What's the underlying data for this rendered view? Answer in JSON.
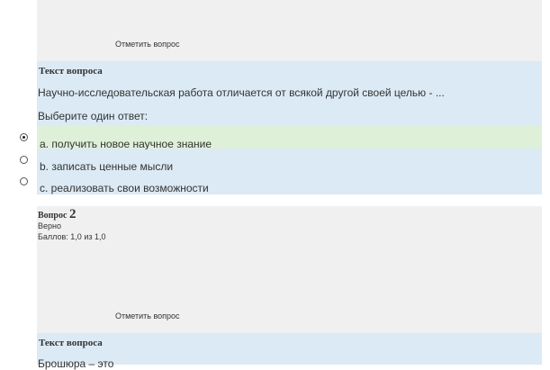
{
  "question1": {
    "flag_label": "Отметить вопрос",
    "qtext_label": "Текст вопроса",
    "qtext": "Научно-исследовательская работа отличается от всякой другой своей целью - ...",
    "prompt": "Выберите один ответ:",
    "answers": [
      {
        "label": "a. получить новое научное знание",
        "selected": true
      },
      {
        "label": "b. записать ценные мысли",
        "selected": false
      },
      {
        "label": "c. реализовать свои возможности",
        "selected": false
      }
    ]
  },
  "question2": {
    "title_prefix": "Вопрос",
    "number": "2",
    "state": "Верно",
    "grade": "Баллов: 1,0 из 1,0",
    "flag_label": "Отметить вопрос",
    "qtext_label": "Текст вопроса",
    "qtext": "Брошюра – это"
  }
}
